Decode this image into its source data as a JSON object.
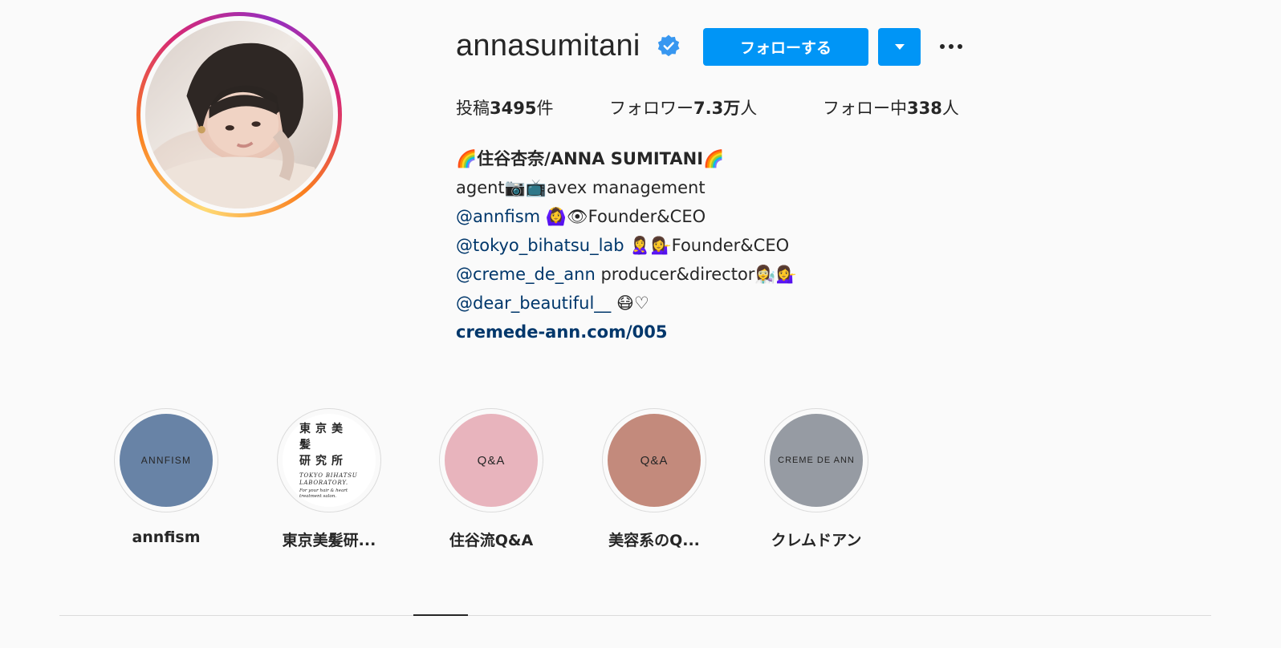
{
  "profile": {
    "username": "annasumitani",
    "verified": true,
    "follow_label": "フォローする",
    "colors": {
      "accent": "#0095f6",
      "link": "#00376b",
      "verified": "#3897f0"
    }
  },
  "stats": {
    "posts_prefix": "投稿",
    "posts_count": "3495",
    "posts_suffix": "件",
    "followers_prefix": "フォロワー",
    "followers_count": "7.3万",
    "followers_suffix": "人",
    "following_prefix": "フォロー中",
    "following_count": "338",
    "following_suffix": "人"
  },
  "bio": {
    "name": "🌈住谷杏奈/ANNA SUMITANI🌈",
    "line1": "agent📷📺avex management",
    "line2_mention": "@annfism",
    "line2_rest": " 🙆‍♀️👁Founder&CEO",
    "line3_mention": "@tokyo_bihatsu_lab",
    "line3_rest": " 🙎‍♀️💁‍♀️Founder&CEO",
    "line4_mention": "@creme_de_ann",
    "line4_rest": " producer&director👩‍🔬💁‍♀️",
    "line5_mention": "@dear_beautiful__",
    "line5_rest": " 😷♡",
    "link": "cremede-ann.com/005"
  },
  "highlights": [
    {
      "title": "annfism",
      "cover_text": "ANNFISM",
      "cover_color": "#6883a6"
    },
    {
      "title": "東京美髪研...",
      "cover_jp": "東京美髪\n研究所",
      "cover_en": "TOKYO BIHATSU LABORATORY.",
      "cover_sub": "For your hair & heart treatment salon.",
      "cover_color": "#ffffff"
    },
    {
      "title": "住谷流Q&A",
      "cover_text": "Q&A",
      "cover_color": "#e8b4bd"
    },
    {
      "title": "美容系のQ...",
      "cover_text": "Q&A",
      "cover_color": "#c38a7c"
    },
    {
      "title": "クレムドアン",
      "cover_text": "CREME DE ANN",
      "cover_color": "#969ba3"
    }
  ]
}
